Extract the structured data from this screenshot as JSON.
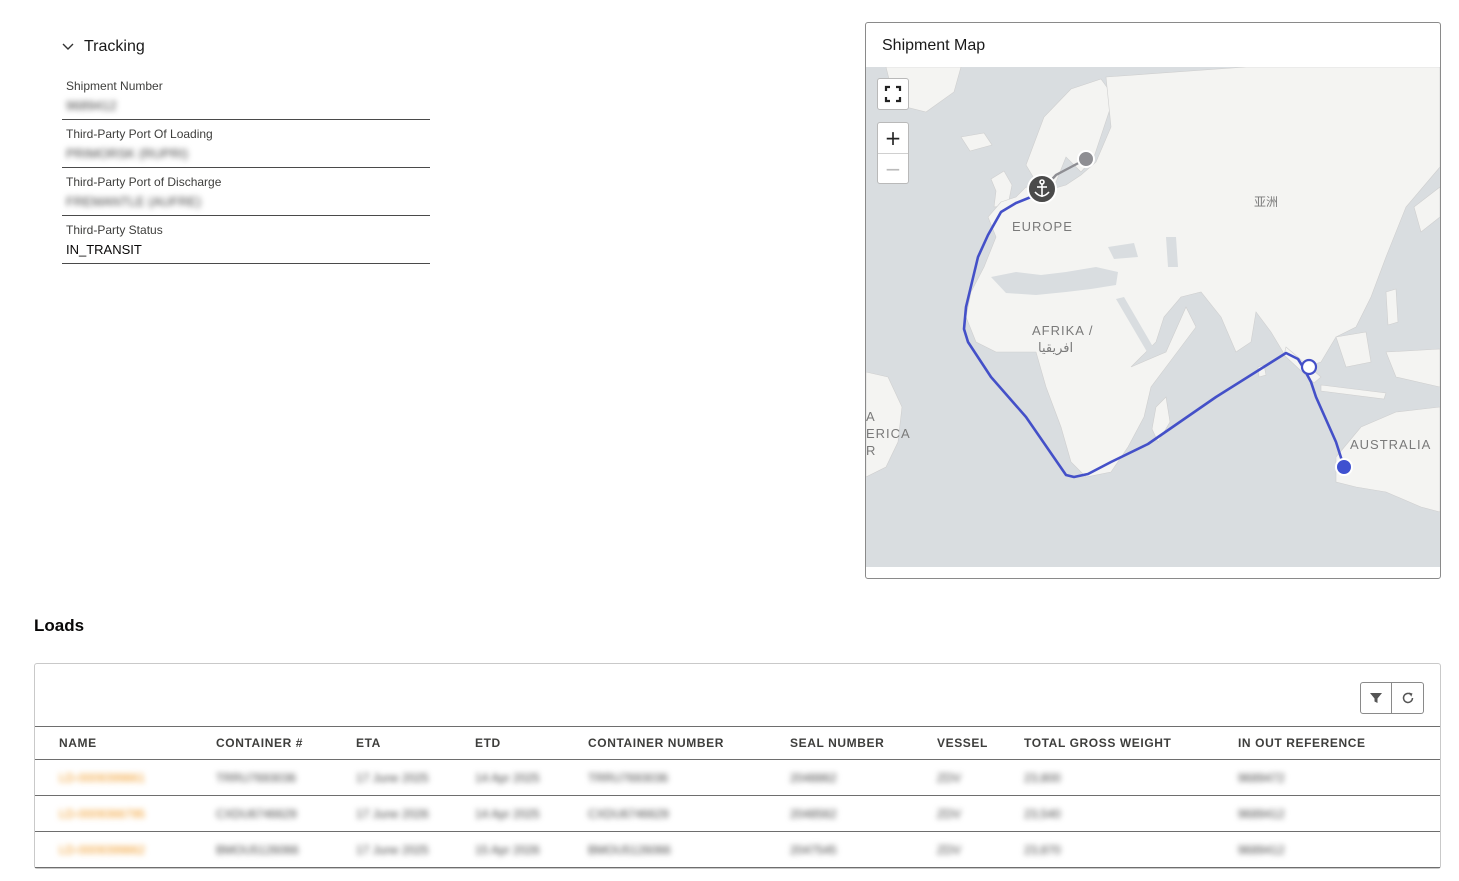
{
  "tracking": {
    "title": "Tracking",
    "fields": [
      {
        "label": "Shipment Number",
        "value": "9689412"
      },
      {
        "label": "Third-Party Port Of Loading",
        "value": "PRIMORSK (RUPRI)"
      },
      {
        "label": "Third-Party Port of Discharge",
        "value": "FREMANTLE (AUFRE)"
      },
      {
        "label": "Third-Party Status",
        "value": "IN_TRANSIT"
      }
    ]
  },
  "map": {
    "title": "Shipment Map",
    "zoom_in": "+",
    "zoom_out": "−",
    "labels": {
      "europe": "EUROPE",
      "africa_1": "AFRIKA /",
      "africa_2": "افريقيا",
      "asia": "亚洲",
      "australia": "AUSTRALIA",
      "america_1": "A",
      "america_2": "ERICA",
      "america_3": "R"
    },
    "colors": {
      "route": "#4450c8",
      "origin": "#8e8e93",
      "destination": "#3f51d0",
      "water": "#d9dde0",
      "land": "#f4f4f2"
    }
  },
  "loads": {
    "title": "Loads",
    "columns": [
      "NAME",
      "CONTAINER #",
      "ETA",
      "ETD",
      "CONTAINER NUMBER",
      "SEAL NUMBER",
      "VESSEL",
      "TOTAL GROSS WEIGHT",
      "IN OUT REFERENCE"
    ],
    "rows": [
      {
        "name": "LD-0009399861",
        "container": "TRRU7693036",
        "eta": "17 June 2025",
        "etd": "14 Apr 2025",
        "container_number": "TRRU7693036",
        "seal": "2048862",
        "vessel": "ZDV",
        "weight": "23,800",
        "ref": "9689472"
      },
      {
        "name": "LD-0009366795",
        "container": "CXDU6746629",
        "eta": "17 June 2026",
        "etd": "14 Apr 2025",
        "container_number": "CXDU6746629",
        "seal": "2048562",
        "vessel": "ZDV",
        "weight": "23,540",
        "ref": "9689412"
      },
      {
        "name": "LD-0009399862",
        "container": "BMOU5126066",
        "eta": "17 June 2025",
        "etd": "15 Apr 2026",
        "container_number": "BMOU5126066",
        "seal": "2047545",
        "vessel": "ZDV",
        "weight": "23,870",
        "ref": "9689412"
      }
    ]
  }
}
